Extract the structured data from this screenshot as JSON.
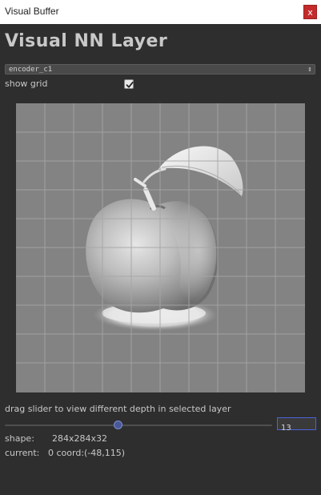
{
  "window": {
    "title": "Visual Buffer",
    "close_label": "x"
  },
  "header": {
    "title": "Visual NN Layer"
  },
  "layer_select": {
    "selected": "encoder_c1",
    "arrow": "⇕"
  },
  "grid_toggle": {
    "label": "show grid",
    "checked": true
  },
  "viewer": {
    "image": "grayscale apple feature map",
    "grid": true
  },
  "depth": {
    "hint": "drag slider to view different depth in selected layer",
    "value": "13",
    "min": 0,
    "max": 31,
    "level": 0.42
  },
  "info": {
    "shape_label": "shape:",
    "shape_value": "284x284x32",
    "current_label": "current:",
    "current_value": "0 coord:(-48,115)"
  },
  "colors": {
    "accent": "#4b63d9",
    "close": "#c42b2b",
    "background": "#2e2e2e"
  }
}
